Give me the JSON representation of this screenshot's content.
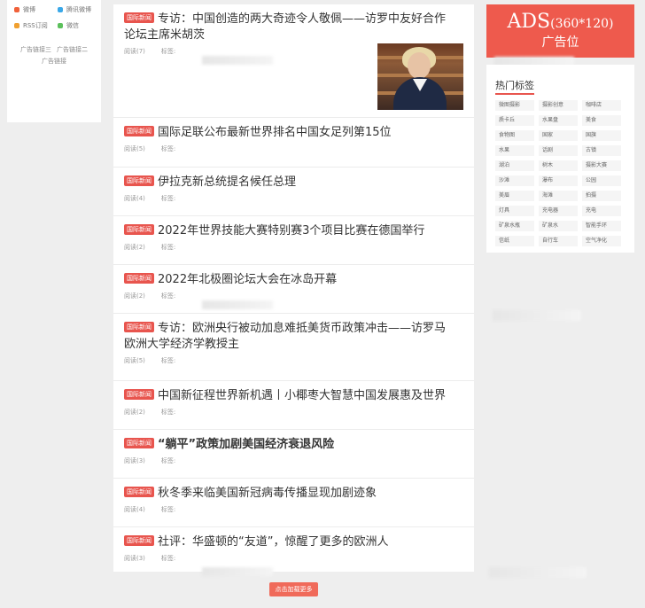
{
  "sidebar": {
    "social": [
      {
        "label": "微博",
        "color": "#f0613a"
      },
      {
        "label": "腾讯微博",
        "color": "#3aa8e8"
      },
      {
        "label": "RSS订阅",
        "color": "#f0a030"
      },
      {
        "label": "微信",
        "color": "#5cc05c"
      }
    ],
    "ad_links": [
      "广告链接三",
      "广告链接二",
      "广告链接"
    ]
  },
  "articles": [
    {
      "badge": "国际新闻",
      "title": "专访：中国创造的两大奇迹令人敬佩——访罗中友好合作论坛主席米胡茨",
      "views": "阅读(7)",
      "tags_label": "标签:",
      "bold": false
    },
    {
      "badge": "国际新闻",
      "title": "国际足联公布最新世界排名中国女足列第15位",
      "views": "阅读(5)",
      "tags_label": "标签:",
      "bold": false
    },
    {
      "badge": "国际新闻",
      "title": "伊拉克新总统提名候任总理",
      "views": "阅读(4)",
      "tags_label": "标签:",
      "bold": false
    },
    {
      "badge": "国际新闻",
      "title": "2022年世界技能大赛特别赛3个项目比赛在德国举行",
      "views": "阅读(2)",
      "tags_label": "标签:",
      "bold": false
    },
    {
      "badge": "国际新闻",
      "title": "2022年北极圈论坛大会在冰岛开幕",
      "views": "阅读(2)",
      "tags_label": "标签:",
      "bold": false
    },
    {
      "badge": "国际新闻",
      "title": "专访：欧洲央行被动加息难抵美货币政策冲击——访罗马欧洲大学经济学教授主",
      "views": "阅读(5)",
      "tags_label": "标签:",
      "bold": false
    },
    {
      "badge": "国际新闻",
      "title": "中国新征程世界新机遇丨小椰枣大智慧中国发展惠及世界",
      "views": "阅读(2)",
      "tags_label": "标签:",
      "bold": false
    },
    {
      "badge": "国际新闻",
      "title": "“躺平”政策加剧美国经济衰退风险",
      "views": "阅读(3)",
      "tags_label": "标签:",
      "bold": true
    },
    {
      "badge": "国际新闻",
      "title": "秋冬季来临美国新冠病毒传播显现加剧迹象",
      "views": "阅读(4)",
      "tags_label": "标签:",
      "bold": false
    },
    {
      "badge": "国际新闻",
      "title": "社评：华盛顿的“友道”，惊醒了更多的欧洲人",
      "views": "阅读(3)",
      "tags_label": "标签:",
      "bold": false
    }
  ],
  "load_more": "点击加载更多",
  "ads": {
    "big": "ADS",
    "dims": "(360*120)",
    "sub": "广告位"
  },
  "hot_tags": {
    "title": "热门标签",
    "items": [
      "微图摄影",
      "摄影创意",
      "咖啡店",
      "质卡丘",
      "水果盘",
      "美食",
      "食物图",
      "国家",
      "国旗",
      "水果",
      "话剧",
      "古镇",
      "湖泊",
      "树木",
      "摄影大赛",
      "沙滩",
      "瀑布",
      "公园",
      "美眉",
      "海滩",
      "拍摄",
      "灯具",
      "充电器",
      "充电",
      "矿泉水瓶",
      "矿泉水",
      "智能手环",
      "信纸",
      "自行车",
      "空气净化"
    ]
  }
}
